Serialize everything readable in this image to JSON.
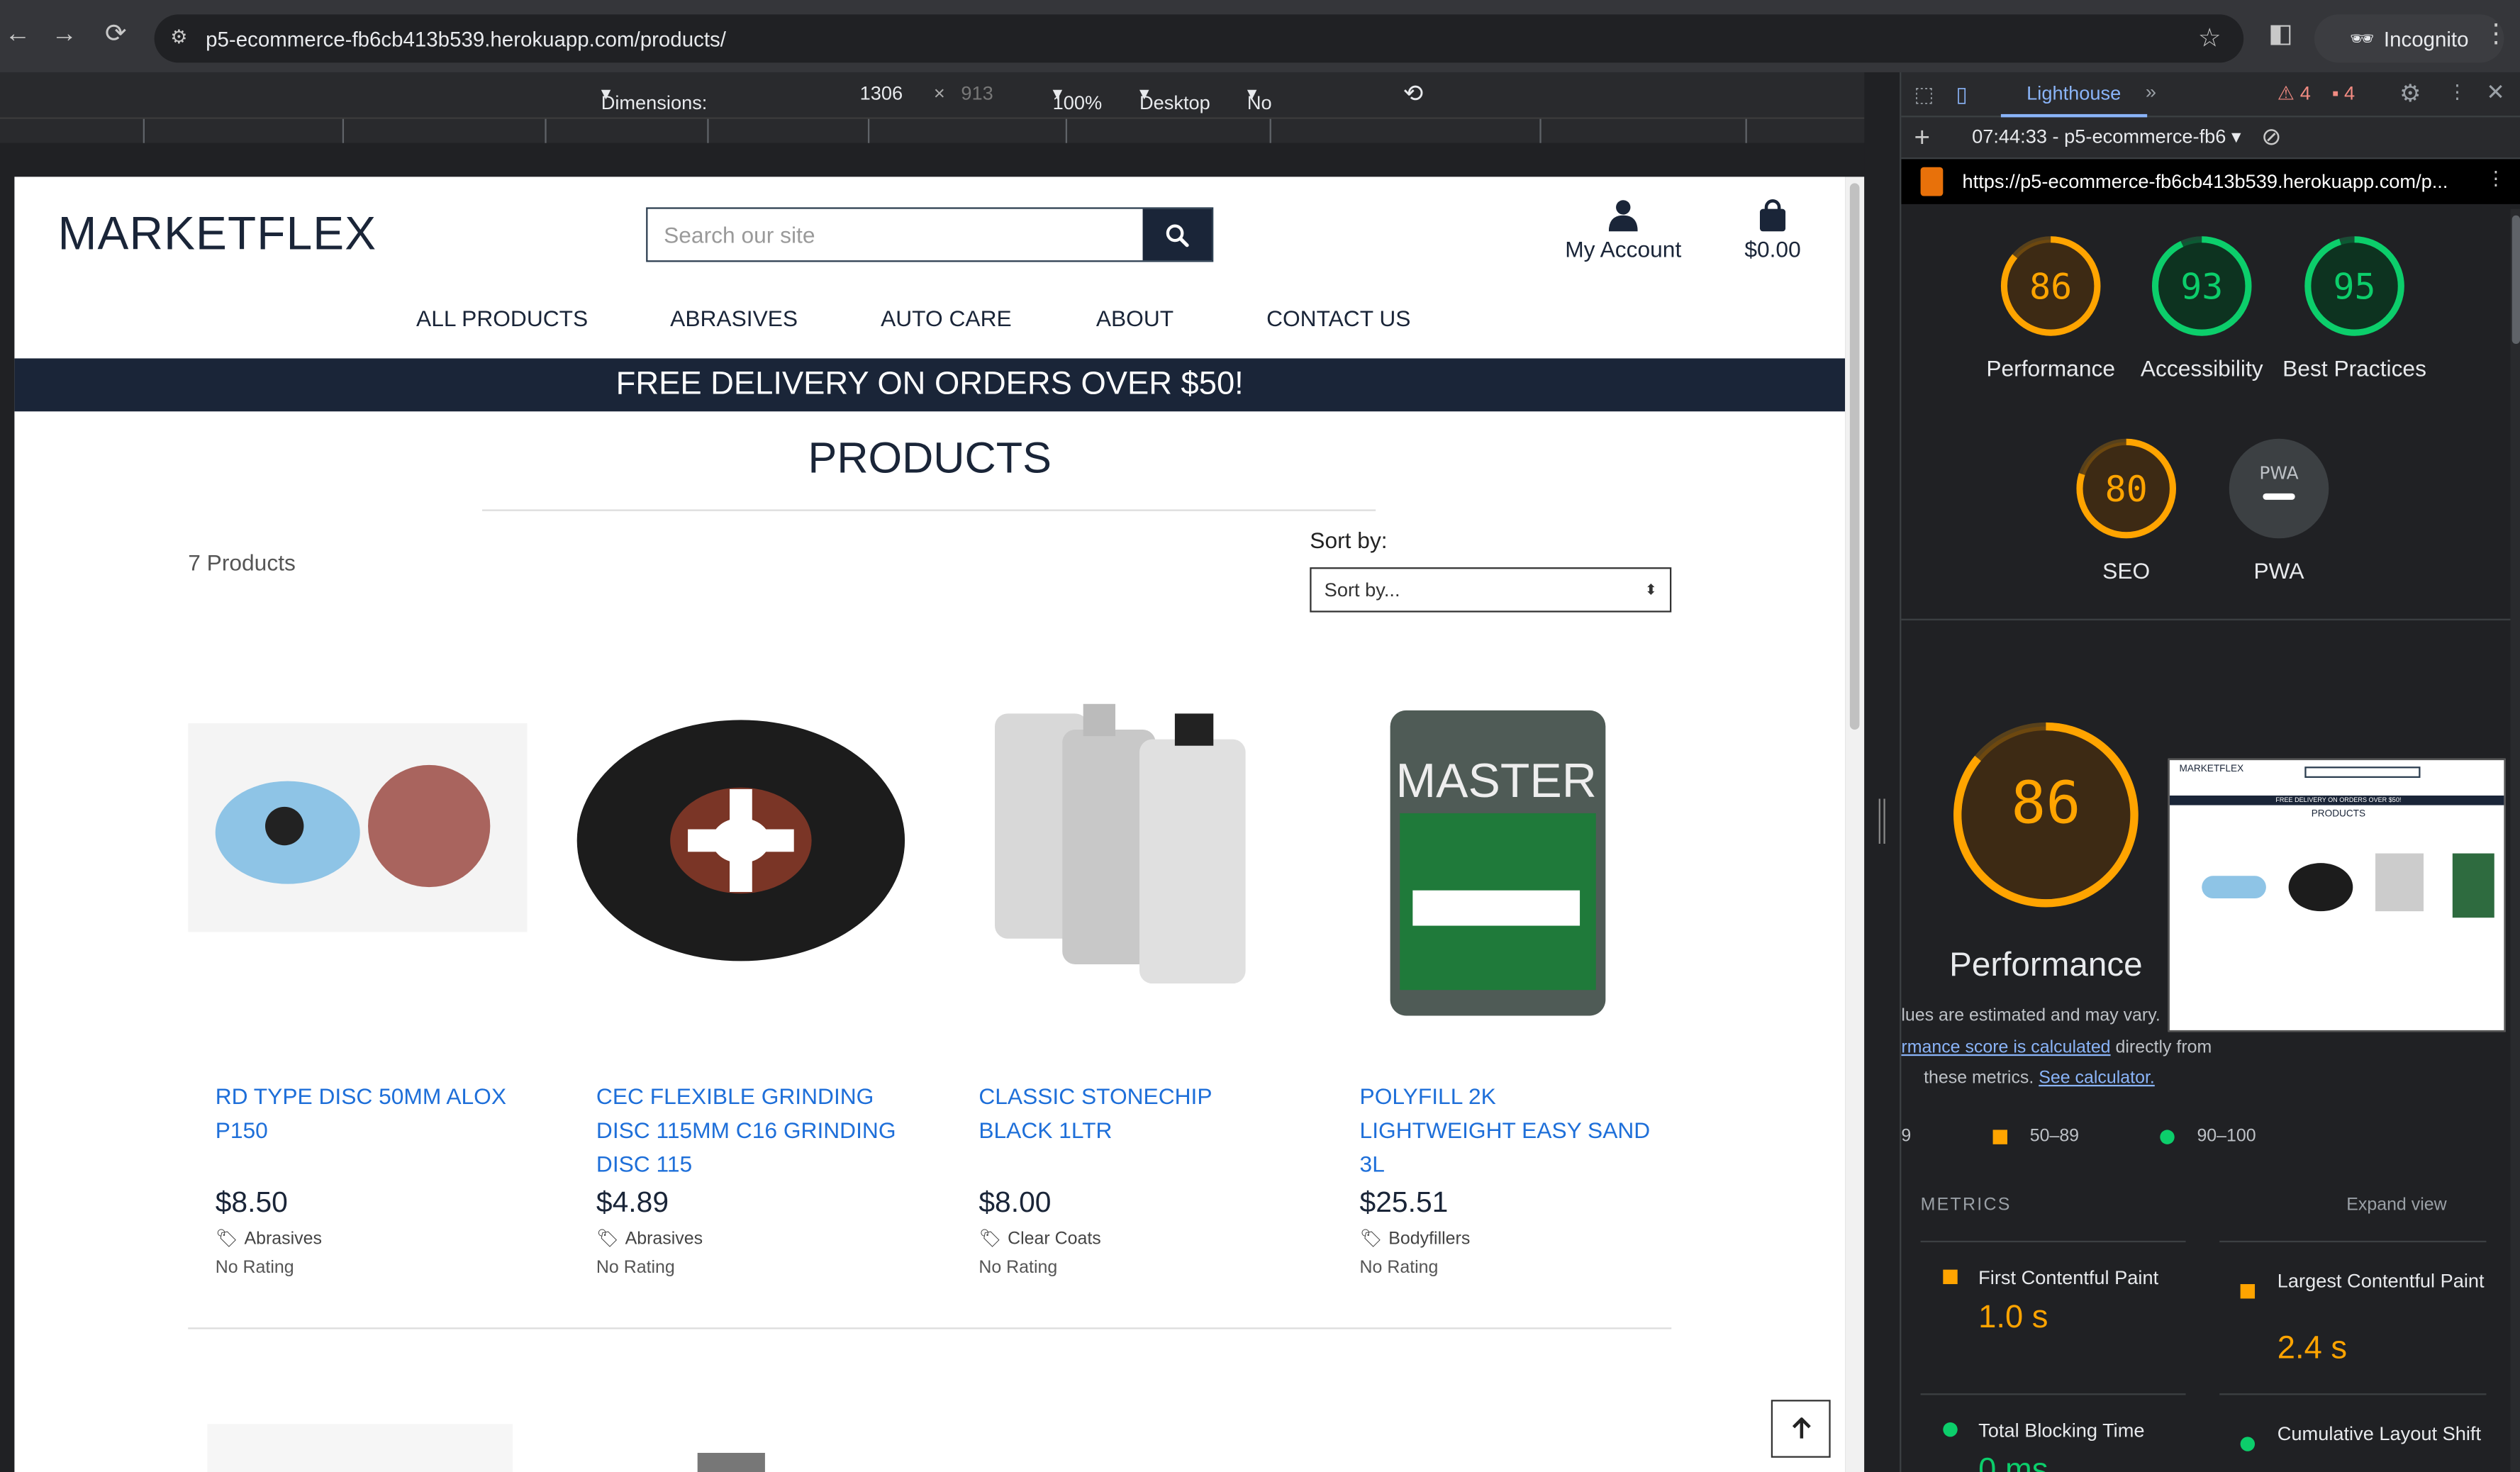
{
  "browser": {
    "url": "p5-ecommerce-fb6cb413b539.herokuapp.com/products/",
    "incognito_label": "Incognito"
  },
  "device_toolbar": {
    "dimensions": "Dimensions: Responsive",
    "width": "1306",
    "times": "×",
    "height": "913",
    "zoom": "100%",
    "device": "Desktop",
    "throttling": "No throttling"
  },
  "site": {
    "logo": "MARKETFLEX",
    "search_placeholder": "Search our site",
    "account_label": "My Account",
    "bag_total": "$0.00",
    "nav": [
      "ALL PRODUCTS",
      "ABRASIVES",
      "AUTO CARE",
      "ABOUT",
      "CONTACT US"
    ],
    "banner": "FREE DELIVERY ON ORDERS OVER $50!",
    "page_title": "PRODUCTS",
    "product_count": "7 Products",
    "sort_label": "Sort by:",
    "sort_value": "Sort by...",
    "products": [
      {
        "name": "RD TYPE DISC 50MM ALOX P150",
        "price": "$8.50",
        "category": "Abrasives",
        "rating": "No Rating"
      },
      {
        "name": "CEC FLEXIBLE GRINDING DISC 115MM C16 GRINDING DISC 115",
        "price": "$4.89",
        "category": "Abrasives",
        "rating": "No Rating"
      },
      {
        "name": "CLASSIC STONECHIP BLACK 1LTR",
        "price": "$8.00",
        "category": "Clear Coats",
        "rating": "No Rating"
      },
      {
        "name": "POLYFILL 2K LIGHTWEIGHT EASY SAND 3L",
        "price": "$25.51",
        "category": "Bodyfillers",
        "rating": "No Rating"
      }
    ]
  },
  "devtools": {
    "tab": "Lighthouse",
    "warnings": "4",
    "errors": "4",
    "report": "07:44:33 - p5-ecommerce-fb6",
    "report_url": "https://p5-ecommerce-fb6cb413b539.herokuapp.com/p...",
    "scores": [
      {
        "label": "Performance",
        "value": 86,
        "color": "#ffa400"
      },
      {
        "label": "Accessibility",
        "value": 93,
        "color": "#0cce6b"
      },
      {
        "label": "Best Practices",
        "value": 95,
        "color": "#0cce6b"
      },
      {
        "label": "SEO",
        "value": 80,
        "color": "#ffa400"
      },
      {
        "label": "PWA",
        "value": "PWA",
        "color": "#9aa0a6"
      }
    ],
    "big_score": "86",
    "big_label": "Performance",
    "note1": "lues are estimated and may vary.",
    "note_link1": "rmance score is calculated",
    "note_mid": " directly from",
    "note2": "these metrics.",
    "note_link2": "See calculator.",
    "legend": [
      {
        "range": "9"
      },
      {
        "range": "50–89"
      },
      {
        "range": "90–100"
      }
    ],
    "metrics_title": "METRICS",
    "expand": "Expand view",
    "metrics": [
      {
        "name": "First Contentful Paint",
        "value": "1.0 s"
      },
      {
        "name": "Largest Contentful Paint",
        "value": "2.4 s"
      },
      {
        "name": "Total Blocking Time",
        "value": "0 ms"
      },
      {
        "name": "Cumulative Layout Shift",
        "value": ""
      }
    ],
    "thumb_logo": "MARKETFLEX",
    "thumb_banner": "FREE DELIVERY ON ORDERS OVER $50!",
    "thumb_title": "PRODUCTS"
  }
}
